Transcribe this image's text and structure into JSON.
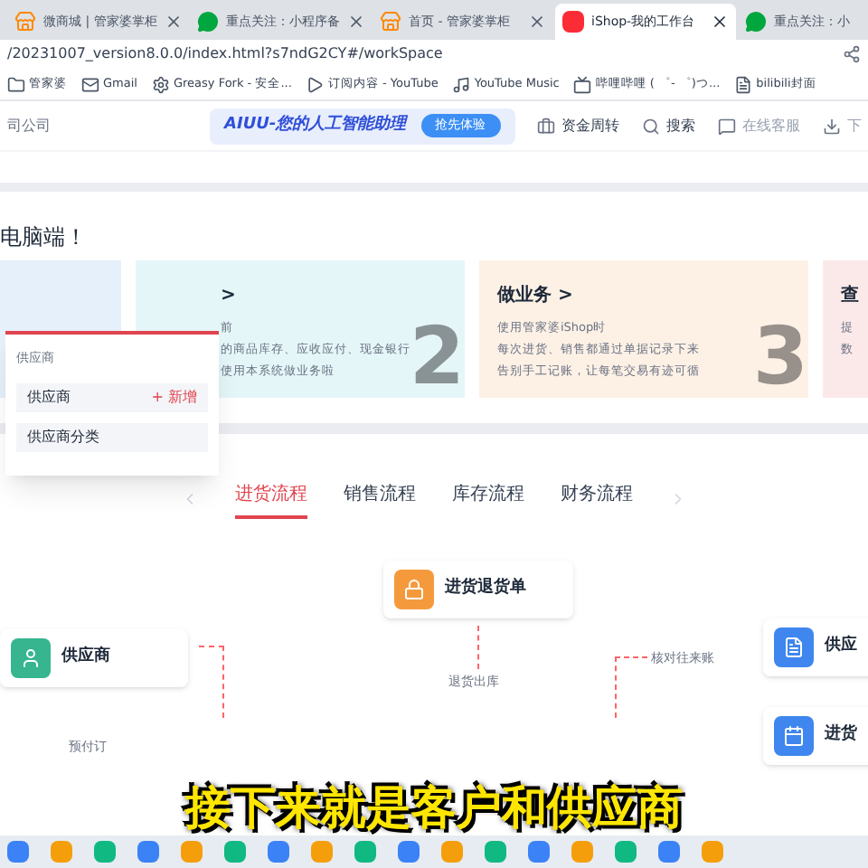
{
  "browser_tabs": [
    {
      "title": "微商城 | 管家婆掌柜",
      "selected": false
    },
    {
      "title": "重点关注：小程序备",
      "selected": false
    },
    {
      "title": "首页 - 管家婆掌柜",
      "selected": false
    },
    {
      "title": "iShop-我的工作台",
      "selected": true
    },
    {
      "title": "重点关注：小",
      "selected": false
    }
  ],
  "address": "/20231007_version8.0.0/index.html?s7ndG2CY#/workSpace",
  "bookmarks": [
    "管家婆",
    "Gmail",
    "Greasy Fork - 安全...",
    "订阅内容 - YouTube",
    "YouTube Music",
    "哔哩哔哩 ( ゜- ゜)つ...",
    "bilibili封面"
  ],
  "header": {
    "company": "司公司",
    "banner": "AIUU-您的人工智能助理",
    "banner_button": "抢先体验",
    "actions": [
      "资金周转",
      "搜索",
      "在线客服",
      "下"
    ]
  },
  "welcome": "电脑端！",
  "cards": [
    {
      "color": "#e6f0fb"
    },
    {
      "title": ">",
      "lines": [
        "前",
        "的商品库存、应收应付、现金银行",
        "使用本系统做业务啦"
      ],
      "number": "2",
      "color": "#e5f6f8"
    },
    {
      "title": "做业务 >",
      "lines": [
        "使用管家婆iShop时",
        "每次进货、销售都通过单据记录下来",
        "告别手工记账，让每笔交易有迹可循"
      ],
      "number": "3",
      "color": "#fdf1e6"
    },
    {
      "title": "查",
      "lines": [
        "提",
        "数"
      ],
      "color": "#fbe9ea"
    }
  ],
  "popup": {
    "heading": "供应商",
    "items": [
      {
        "label": "供应商",
        "action": "+ 新增"
      },
      {
        "label": "供应商分类"
      }
    ]
  },
  "flow_tabs": [
    {
      "label": "进货流程",
      "selected": true
    },
    {
      "label": "销售流程",
      "selected": false
    },
    {
      "label": "库存流程",
      "selected": false
    },
    {
      "label": "财务流程",
      "selected": false
    }
  ],
  "flow_nodes": [
    {
      "label": "进货退货单",
      "color": "#f59a3c"
    },
    {
      "label": "供应商",
      "color": "#36b58e"
    },
    {
      "label": "供应",
      "color": "#3f86ee"
    },
    {
      "label": "进货",
      "color": "#3f86ee"
    }
  ],
  "flow_labels": [
    "退货出库",
    "核对往来账",
    "预付订"
  ],
  "subtitle": "接下来就是客户和供应商"
}
